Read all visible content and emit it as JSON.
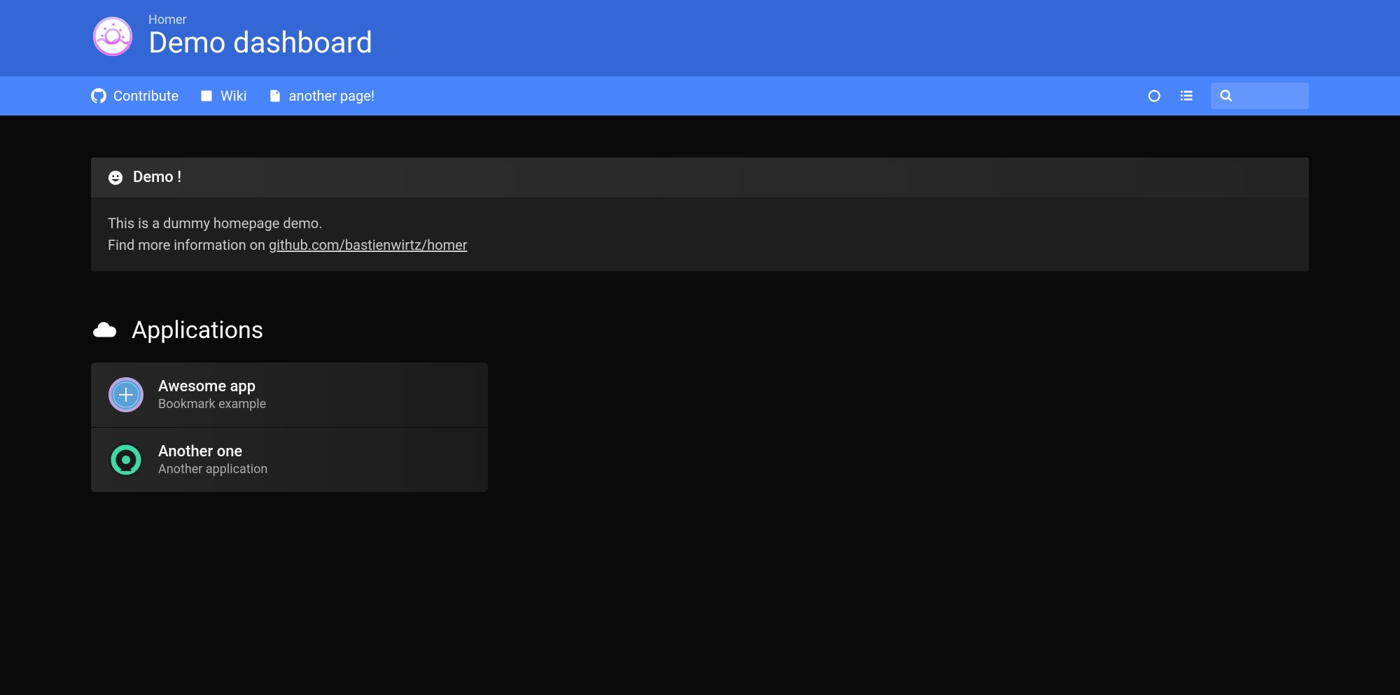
{
  "header": {
    "app_name": "Homer",
    "title": "Demo dashboard"
  },
  "nav": {
    "links": [
      {
        "label": "Contribute",
        "icon": "github-icon"
      },
      {
        "label": "Wiki",
        "icon": "book-icon"
      },
      {
        "label": "another page!",
        "icon": "file-icon"
      }
    ]
  },
  "message": {
    "title": "Demo !",
    "body_line1": "This is a dummy homepage demo.",
    "body_line2_prefix": "Find more information on ",
    "body_line2_link": "github.com/bastienwirtz/homer"
  },
  "section": {
    "title": "Applications"
  },
  "apps": [
    {
      "title": "Awesome app",
      "subtitle": "Bookmark example"
    },
    {
      "title": "Another one",
      "subtitle": "Another application"
    }
  ],
  "search": {
    "placeholder": ""
  }
}
